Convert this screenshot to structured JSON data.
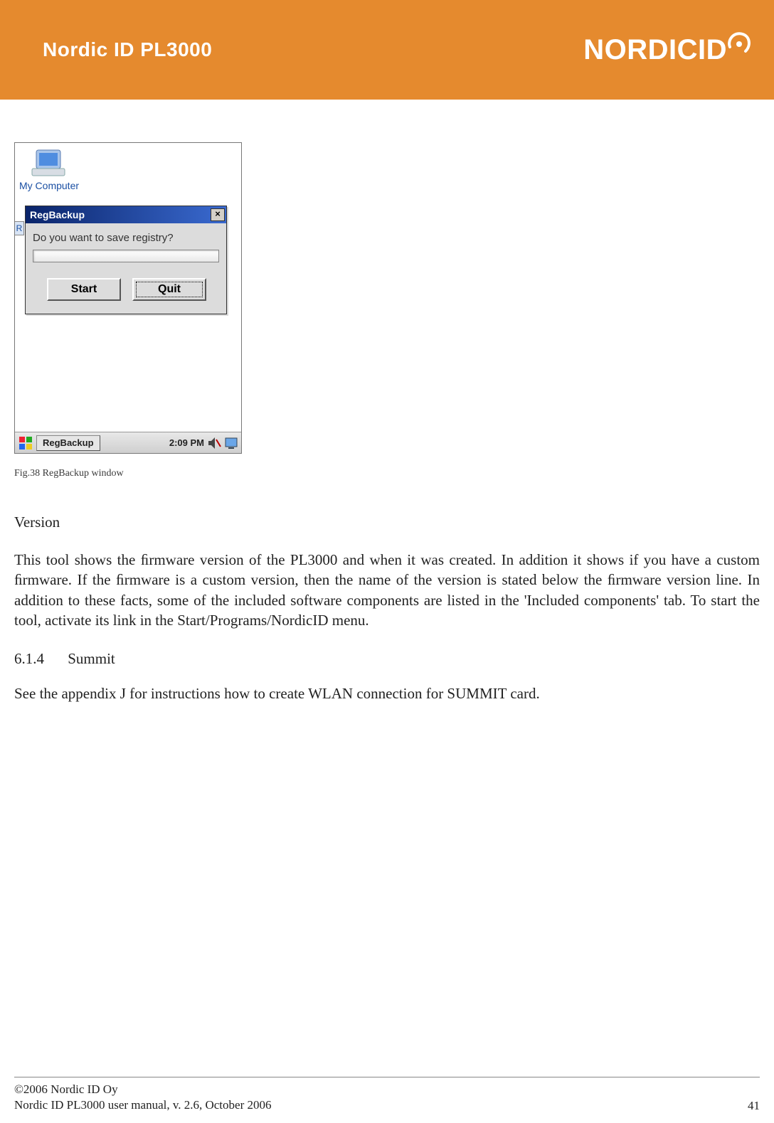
{
  "header": {
    "title": "Nordic ID PL3000",
    "logo_text": "NORDICID"
  },
  "screenshot": {
    "desktop": {
      "my_computer_label": "My Computer",
      "r_tab": "R"
    },
    "dialog": {
      "title": "RegBackup",
      "close": "×",
      "message": "Do you want to save registry?",
      "start_btn": "Start",
      "quit_btn": "Quit"
    },
    "taskbar": {
      "task_label": "RegBackup",
      "clock": "2:09 PM"
    }
  },
  "caption": "Fig.38 RegBackup window",
  "sections": {
    "version_label": "Version",
    "version_body": "This tool shows the ﬁrmware version of the PL3000 and when it was created. In addition it shows if you have a custom ﬁrmware. If the ﬁrmware is a custom version, then the name of the version is stated below the ﬁrmware version line. In addition to these facts, some of the included software components are listed in the 'Included components' tab. To start the tool, activate its link in the Start/Programs/NordicID menu.",
    "summit_num": "6.1.4",
    "summit_title": "Summit",
    "summit_body": "See the appendix J for instructions how to create WLAN connection for SUMMIT card."
  },
  "footer": {
    "line1": "©2006 Nordic ID Oy",
    "line2": "Nordic ID PL3000 user manual, v. 2.6, October 2006",
    "page": "41"
  }
}
